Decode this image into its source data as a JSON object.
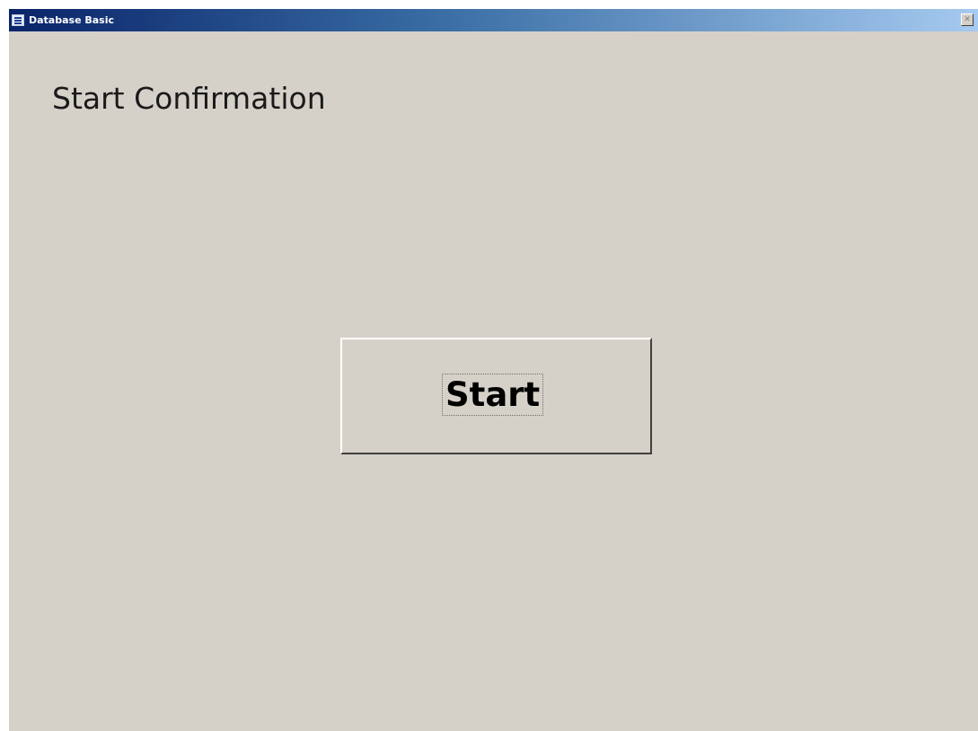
{
  "window": {
    "title": "Database Basic",
    "icon": "database-form-icon",
    "close_icon": "close-icon",
    "close_glyph": "✕",
    "background_color": "#d5d1c9",
    "titlebar_gradient": [
      "#0a246a",
      "#a6caf0"
    ]
  },
  "form": {
    "heading": "Start Confirmation",
    "start_button_label": "Start"
  }
}
